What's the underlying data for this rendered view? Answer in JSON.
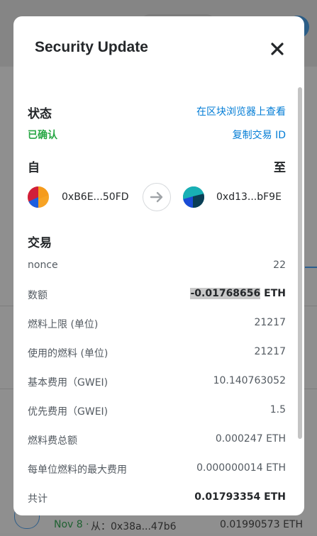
{
  "modal": {
    "title": "Security Update"
  },
  "status": {
    "label": "状态",
    "view_link": "在区块浏览器上查看",
    "value": "已确认",
    "copy_link": "复制交易 ID"
  },
  "from_to": {
    "from_label": "自",
    "to_label": "至",
    "from_address": "0xB6E...50FD",
    "to_address": "0xd13...bF9E"
  },
  "transaction": {
    "heading": "交易",
    "rows": [
      {
        "label": "nonce",
        "value": "22"
      },
      {
        "label": "数额",
        "value_prefix": "-0.01768656",
        "value_suffix": " ETH"
      },
      {
        "label": "燃料上限 (单位)",
        "value": "21217"
      },
      {
        "label": "使用的燃料 (单位)",
        "value": "21217"
      },
      {
        "label": "基本费用（GWEI)",
        "value": "10.140763052"
      },
      {
        "label": "优先费用（GWEI)",
        "value": "1.5"
      },
      {
        "label": "燃料费总额",
        "value": "0.000247 ETH"
      },
      {
        "label": "每单位燃料的最大费用",
        "value": "0.000000014 ETH"
      },
      {
        "label": "共计",
        "value": "0.01793354 ETH"
      }
    ]
  },
  "background_tx": {
    "date": "Nov 8 ·",
    "from": "从：0x38a...47b6",
    "amount": "0.01990573 ETH"
  },
  "icons": {
    "close": "close-icon",
    "arrow": "arrow-right-icon"
  },
  "colors": {
    "link": "#037dd6",
    "success": "#28a745"
  }
}
